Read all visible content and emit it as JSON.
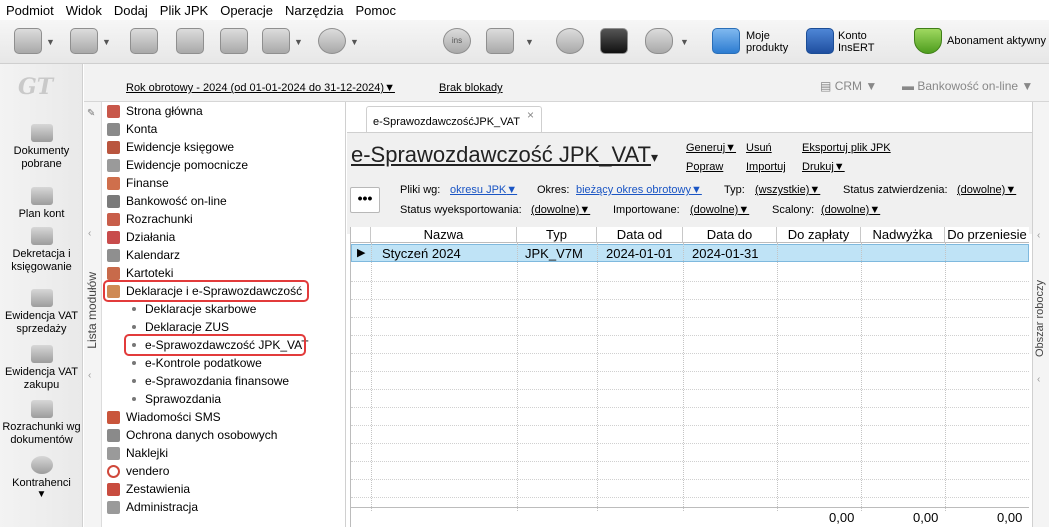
{
  "menu": [
    "Podmiot",
    "Widok",
    "Dodaj",
    "Plik JPK",
    "Operacje",
    "Narzędzia",
    "Pomoc"
  ],
  "toolbar": {
    "moje_produkty": "Moje produkty",
    "konto_insert": "Konto InsERT",
    "abonament": "Abonament aktywny",
    "ins_label": "ins"
  },
  "leftnav": {
    "logo": "GT",
    "items": [
      "Dokumenty pobrane",
      "Plan kont",
      "Dekretacja i księgowanie",
      "Ewidencja VAT sprzedaży",
      "Ewidencja VAT zakupu",
      "Rozrachunki wg dokumentów",
      "Kontrahenci"
    ]
  },
  "header": {
    "rok": "Rok obrotowy - 2024  (od 01-01-2024 do 31-12-2024)",
    "blokada": "Brak blokady",
    "crm": "CRM",
    "bankowosc": "Bankowość on-line"
  },
  "modules": {
    "side_label": "Lista modułów",
    "items": [
      "Strona główna",
      "Konta",
      "Ewidencje księgowe",
      "Ewidencje pomocnicze",
      "Finanse",
      "Bankowość on-line",
      "Rozrachunki",
      "Działania",
      "Kalendarz",
      "Kartoteki",
      "Deklaracje i e-Sprawozdawczość"
    ],
    "subitems": [
      "Deklaracje skarbowe",
      "Deklaracje ZUS",
      "e-Sprawozdawczość JPK_VAT",
      "e-Kontrole podatkowe",
      "e-Sprawozdania finansowe",
      "Sprawozdania"
    ],
    "after": [
      "Wiadomości SMS",
      "Ochrona danych osobowych",
      "Naklejki",
      "vendero",
      "Zestawienia",
      "Administracja"
    ]
  },
  "tab": {
    "label": "e-SprawozdawczośćJPK_VAT",
    "close": "×"
  },
  "page": {
    "title": "e-Sprawozdawczość JPK_VAT",
    "links": {
      "generuj": "Generuj",
      "usun": "Usuń",
      "eksportuj": "Eksportuj plik JPK",
      "popraw": "Popraw",
      "importuj": "Importuj",
      "drukuj": "Drukuj"
    }
  },
  "filters": {
    "pliki_wg_label": "Pliki wg:",
    "pliki_wg_value": "okresu JPK",
    "okres_label": "Okres:",
    "okres_value": "bieżący okres obrotowy",
    "typ_label": "Typ:",
    "typ_value": "(wszystkie)",
    "status_zatw_label": "Status zatwierdzenia:",
    "status_zatw_value": "(dowolne)",
    "status_eksp_label": "Status wyeksportowania:",
    "status_eksp_value": "(dowolne)",
    "importowane_label": "Importowane:",
    "importowane_value": "(dowolne)",
    "scalony_label": "Scalony:",
    "scalony_value": "(dowolne)"
  },
  "grid": {
    "columns": [
      "Nazwa",
      "Typ",
      "Data od",
      "Data do",
      "Do zapłaty",
      "Nadwyżka",
      "Do przeniesie"
    ],
    "rows": [
      {
        "nazwa": "Styczeń 2024",
        "typ": "JPK_V7M",
        "data_od": "2024-01-01",
        "data_do": "2024-01-31"
      }
    ],
    "totals": {
      "do_zaplaty": "0,00",
      "nadwyzka": "0,00",
      "do_przeniesienia": "0,00"
    }
  },
  "right_strip": {
    "label": "Obszar roboczy"
  }
}
